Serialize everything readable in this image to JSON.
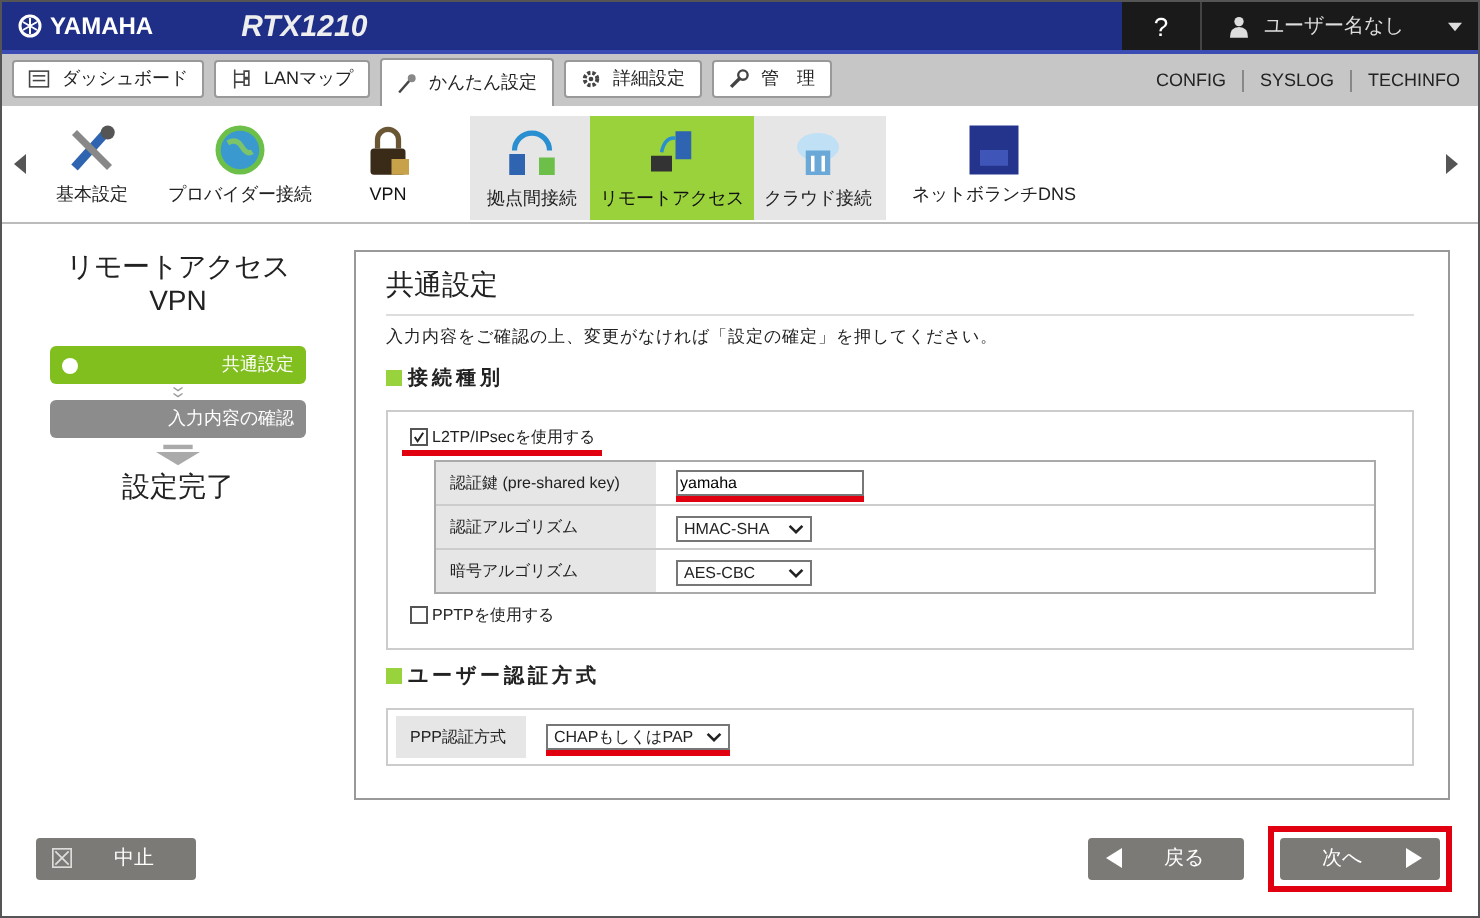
{
  "header": {
    "brand": "YAMAHA",
    "model": "RTX1210",
    "help": "?",
    "user": "ユーザー名なし"
  },
  "tabs": [
    {
      "label": "ダッシュボード",
      "selected": false
    },
    {
      "label": "LANマップ",
      "selected": false
    },
    {
      "label": "かんたん設定",
      "selected": true
    },
    {
      "label": "詳細設定",
      "selected": false
    },
    {
      "label": "管　理",
      "selected": false
    }
  ],
  "links": [
    "CONFIG",
    "SYSLOG",
    "TECHINFO"
  ],
  "categories": [
    {
      "label": "基本設定",
      "selected": false
    },
    {
      "label": "プロバイダー接続",
      "selected": false
    },
    {
      "label": "VPN",
      "selected": true
    }
  ],
  "subcategories": [
    {
      "label": "拠点間接続",
      "selected": false
    },
    {
      "label": "リモートアクセス",
      "selected": true
    },
    {
      "label": "クラウド接続",
      "selected": false
    }
  ],
  "extra_categories": [
    {
      "label": "ネットボランチDNS",
      "selected": false
    }
  ],
  "wizard": {
    "title": "リモートアクセス\nVPN",
    "steps": [
      {
        "label": "共通設定",
        "selected": true
      },
      {
        "label": "入力内容の確認",
        "selected": false
      }
    ],
    "done": "設定完了"
  },
  "panel": {
    "title": "共通設定",
    "instruction": "入力内容をご確認の上、変更がなければ「設定の確定」を押してください。",
    "sections": [
      {
        "heading": "接続種別",
        "kind": "connection",
        "options": [
          {
            "label": "L2TP/IPsecを使用する",
            "checked": true,
            "annotated": true,
            "fields": [
              {
                "label": "認証鍵 (pre-shared key)",
                "kind": "text",
                "value": "yamaha",
                "annotated": true
              },
              {
                "label": "認証アルゴリズム",
                "kind": "select",
                "value": "HMAC-SHA",
                "annotated": false
              },
              {
                "label": "暗号アルゴリズム",
                "kind": "select",
                "value": "AES-CBC",
                "annotated": false
              }
            ]
          },
          {
            "label": "PPTPを使用する",
            "checked": false,
            "annotated": false
          }
        ]
      },
      {
        "heading": "ユーザー認証方式",
        "kind": "fields",
        "fields": [
          {
            "label": "PPP認証方式",
            "kind": "select",
            "value": "CHAPもしくはPAP",
            "annotated": true
          }
        ]
      }
    ]
  },
  "buttons": [
    {
      "label": "中止",
      "kind": "cancel",
      "annotated": false
    },
    {
      "label": "戻る",
      "kind": "back",
      "annotated": false
    },
    {
      "label": "次へ",
      "kind": "next",
      "annotated": true
    }
  ]
}
